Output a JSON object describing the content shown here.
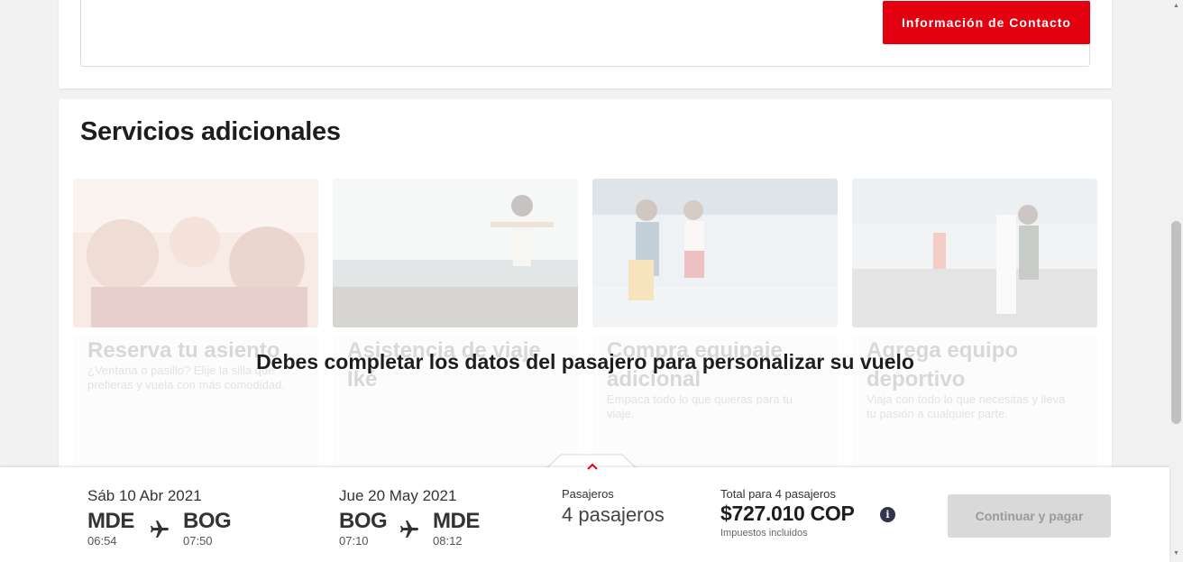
{
  "contact": {
    "button_label": "Información de Contacto"
  },
  "services": {
    "title": "Servicios adicionales",
    "overlay_message": "Debes completar los datos del pasajero para personalizar su vuelo",
    "tiles": [
      {
        "title": "Reserva tu asiento",
        "description": "¿Ventana o pasillo? Elije la silla que prefieras y vuela con más comodidad."
      },
      {
        "title": "Asistencia de viaje Iké",
        "description": ""
      },
      {
        "title": "Compra equipaje adicional",
        "description": "Empaca todo lo que quieras para tu viaje."
      },
      {
        "title": "Agrega equipo deportivo",
        "description": "Viaja con todo lo que necesitas y lleva tu pasión a cualquier parte."
      }
    ]
  },
  "summary": {
    "outbound": {
      "date": "Sáb 10 Abr 2021",
      "origin": "MDE",
      "destination": "BOG",
      "depart_time": "06:54",
      "arrive_time": "07:50"
    },
    "inbound": {
      "date": "Jue 20 May 2021",
      "origin": "BOG",
      "destination": "MDE",
      "depart_time": "07:10",
      "arrive_time": "08:12"
    },
    "passengers_label": "Pasajeros",
    "passengers_value": "4 pasajeros",
    "total_label": "Total para 4 pasajeros",
    "total_value": "$727.010 COP",
    "tax_note": "Impuestos incluidos",
    "pay_button": "Continuar y pagar",
    "info_icon": "i"
  },
  "colors": {
    "brand_red": "#e3000f",
    "disabled_button": "#d9d9d9",
    "text_dark": "#1d1d1d"
  }
}
